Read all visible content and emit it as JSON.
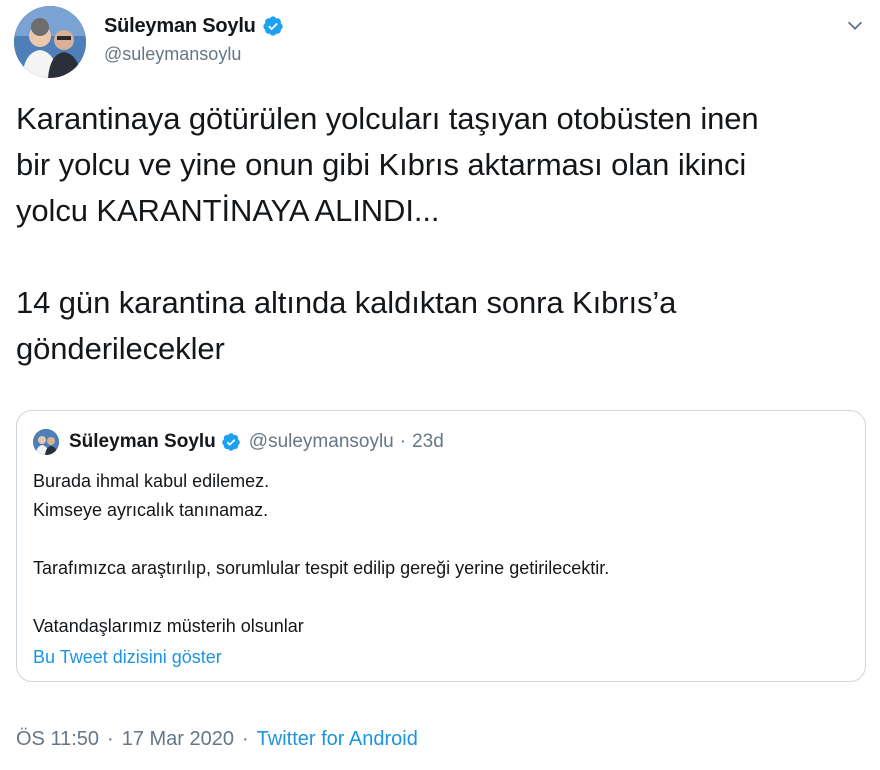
{
  "author": {
    "display_name": "Süleyman Soylu",
    "handle": "@suleymansoylu",
    "avatar_icon": "profile-photo",
    "verified_icon": "verified-badge-icon"
  },
  "tweet": {
    "paragraphs": [
      [
        "Karantinaya götürülen yolcuları taşıyan otobüsten inen",
        "bir yolcu ve yine onun gibi Kıbrıs aktarması olan ikinci",
        "yolcu KARANTİNAYA ALINDI..."
      ],
      [
        "14 gün karantina altında kaldıktan sonra Kıbrıs’a",
        "gönderilecekler"
      ]
    ]
  },
  "quoted": {
    "display_name": "Süleyman Soylu",
    "handle": "@suleymansoylu",
    "separator": "·",
    "time": "23d",
    "lines": [
      "Burada ihmal kabul edilemez.",
      "Kimseye ayrıcalık tanınamaz.",
      "",
      "Tarafımızca araştırılıp, sorumlular tespit edilip gereği yerine getirilecektir.",
      "",
      "Vatandaşlarımız müsterih olsunlar"
    ],
    "thread_link": "Bu Tweet dizisini göster"
  },
  "meta": {
    "time": "ÖS 11:50",
    "separator": "·",
    "date": "17 Mar 2020",
    "source": "Twitter for Android"
  },
  "colors": {
    "primary_text": "#14171a",
    "secondary_text": "#657786",
    "link": "#1b95e0",
    "verified": "#1da1f2",
    "border": "#ccd6dd"
  }
}
